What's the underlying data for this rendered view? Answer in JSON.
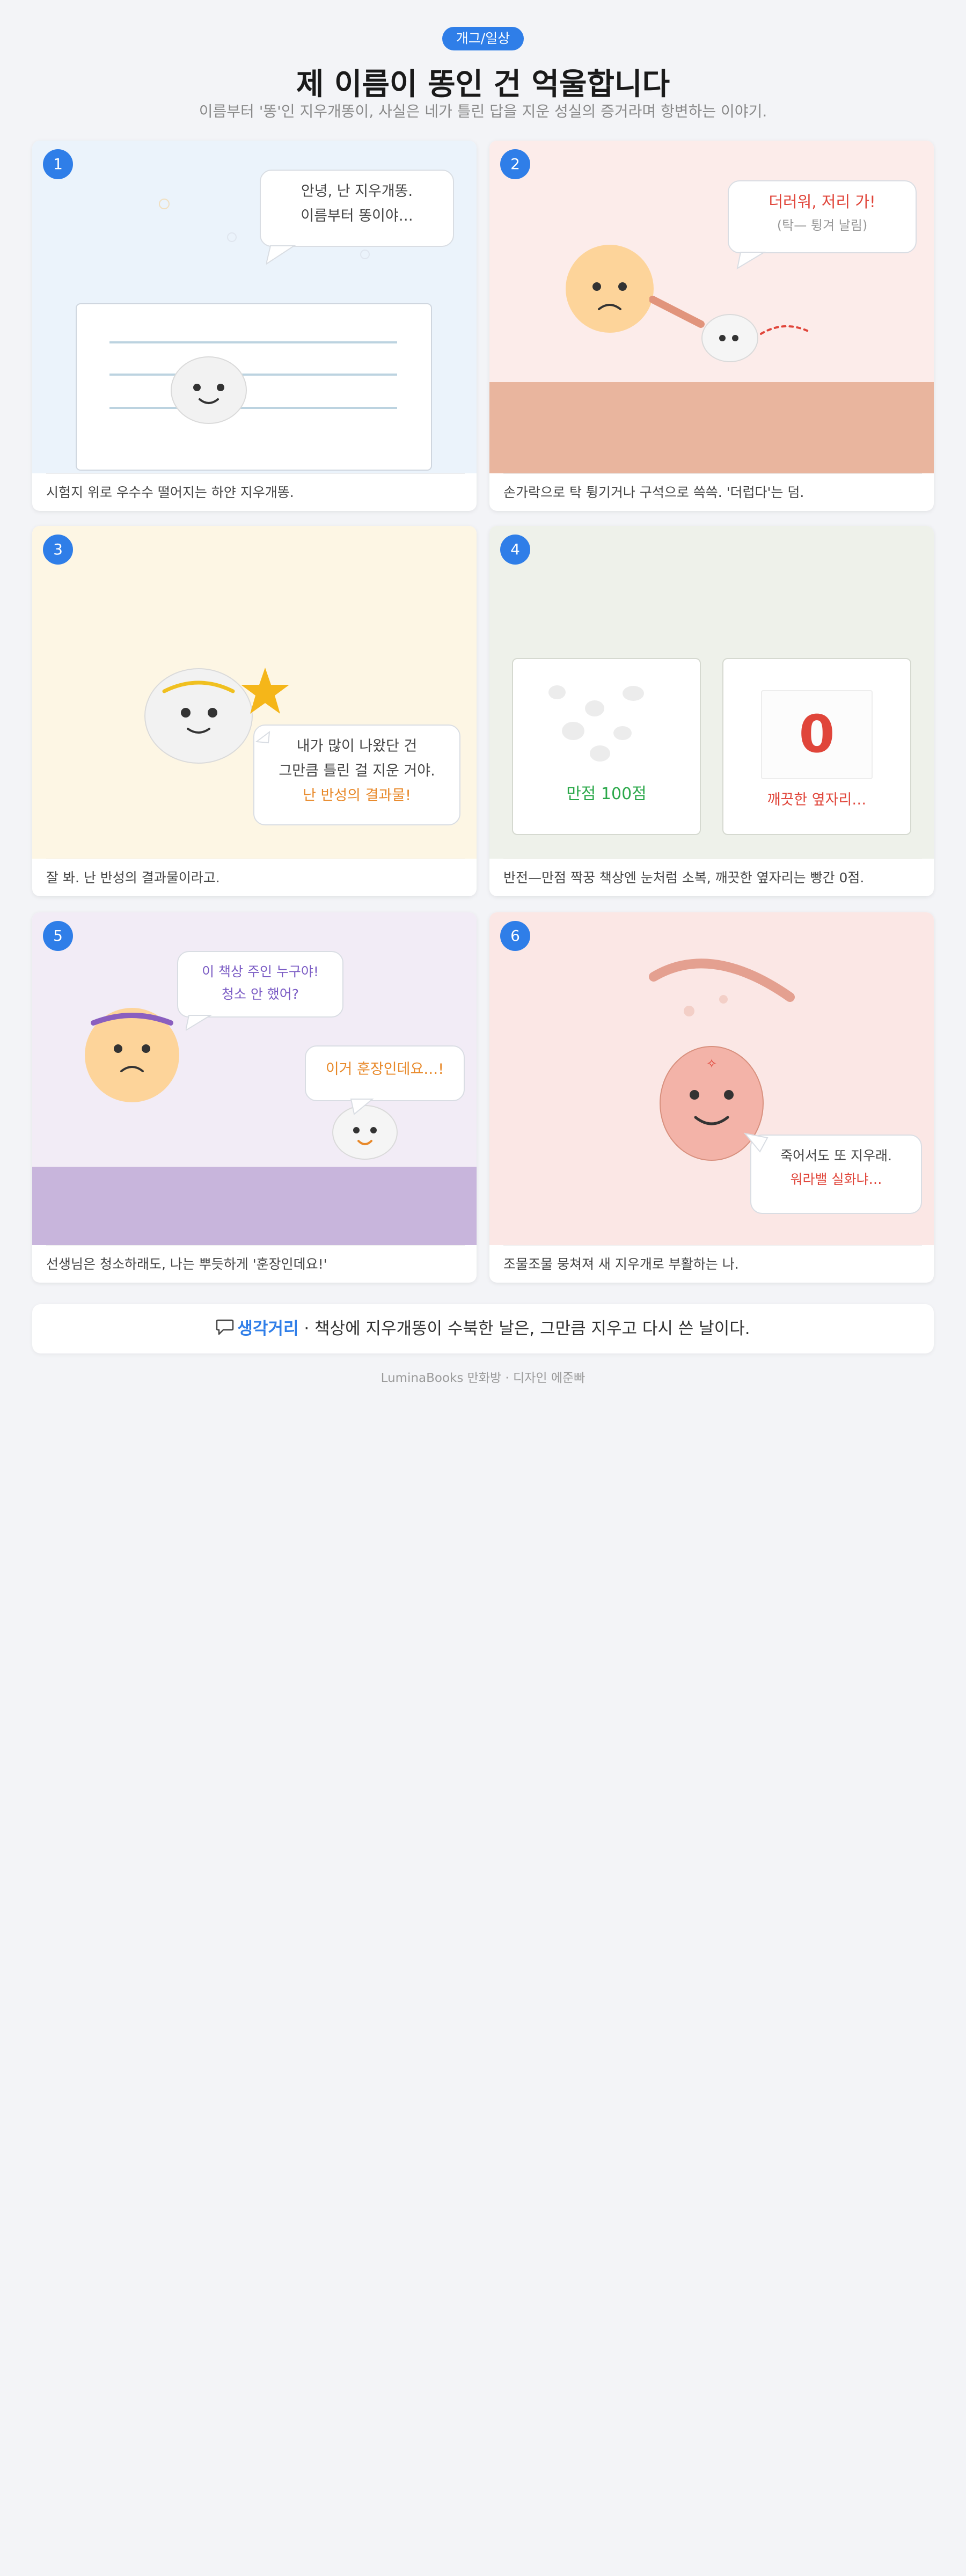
{
  "header": {
    "tag": "개그/일상",
    "title": "제 이름이 똥인 건 억울합니다",
    "subtitle": "이름부터 '똥'인 지우개똥이, 사실은 네가 틀린 답을 지운 성실의 증거라며 항변하는 이야기."
  },
  "panels": [
    {
      "number": "1",
      "bubble_lines": [
        "안녕, 난 지우개똥.",
        "이름부터 똥이야…"
      ],
      "caption": "시험지 위로 우수수 떨어지는 하얀 지우개똥."
    },
    {
      "number": "2",
      "bubble_lines": [
        "더러워, 저리 가!",
        "(탁— 튕겨 날림)"
      ],
      "caption": "손가락으로 탁 튕기거나 구석으로 쓱쓱. '더럽다'는 덤."
    },
    {
      "number": "3",
      "bubble_lines": [
        "내가 많이 나왔단 건",
        "그만큼 틀린 걸 지운 거야.",
        "난 반성의 결과물!"
      ],
      "caption": "잘 봐. 난 반성의 결과물이라고."
    },
    {
      "number": "4",
      "card_left_label": "만점 100점",
      "card_right_value": "0",
      "card_right_label": "깨끗한 옆자리…",
      "caption": "반전—만점 짝꿍 책상엔 눈처럼 소복, 깨끗한 옆자리는 빵간 0점."
    },
    {
      "number": "5",
      "bubble1_lines": [
        "이 책상 주인 누구야!",
        "청소 안 했어?"
      ],
      "bubble2_text": "이거 훈장인데요…!",
      "caption": "선생님은 청소하래도, 나는 뿌듯하게 '훈장인데요!'"
    },
    {
      "number": "6",
      "bubble_lines": [
        "죽어서도 또 지우래.",
        "워라밸 실화냐…"
      ],
      "caption": "조물조물 뭉쳐져 새 지우개로 부활하는 나."
    }
  ],
  "footer": {
    "icon": "speech-bubble-icon",
    "highlight": "생각거리",
    "text": " · 책상에 지우개똥이 수북한 날은, 그만큼 지우고 다시 쓴 날이다."
  },
  "credit": "LuminaBooks 만화방 · 디자인 에준빠",
  "colors": {
    "accent": "#2f7ee8",
    "red": "#e0453a",
    "green": "#2ba84a",
    "orange": "#e8892a",
    "purple": "#7a5bc4"
  }
}
